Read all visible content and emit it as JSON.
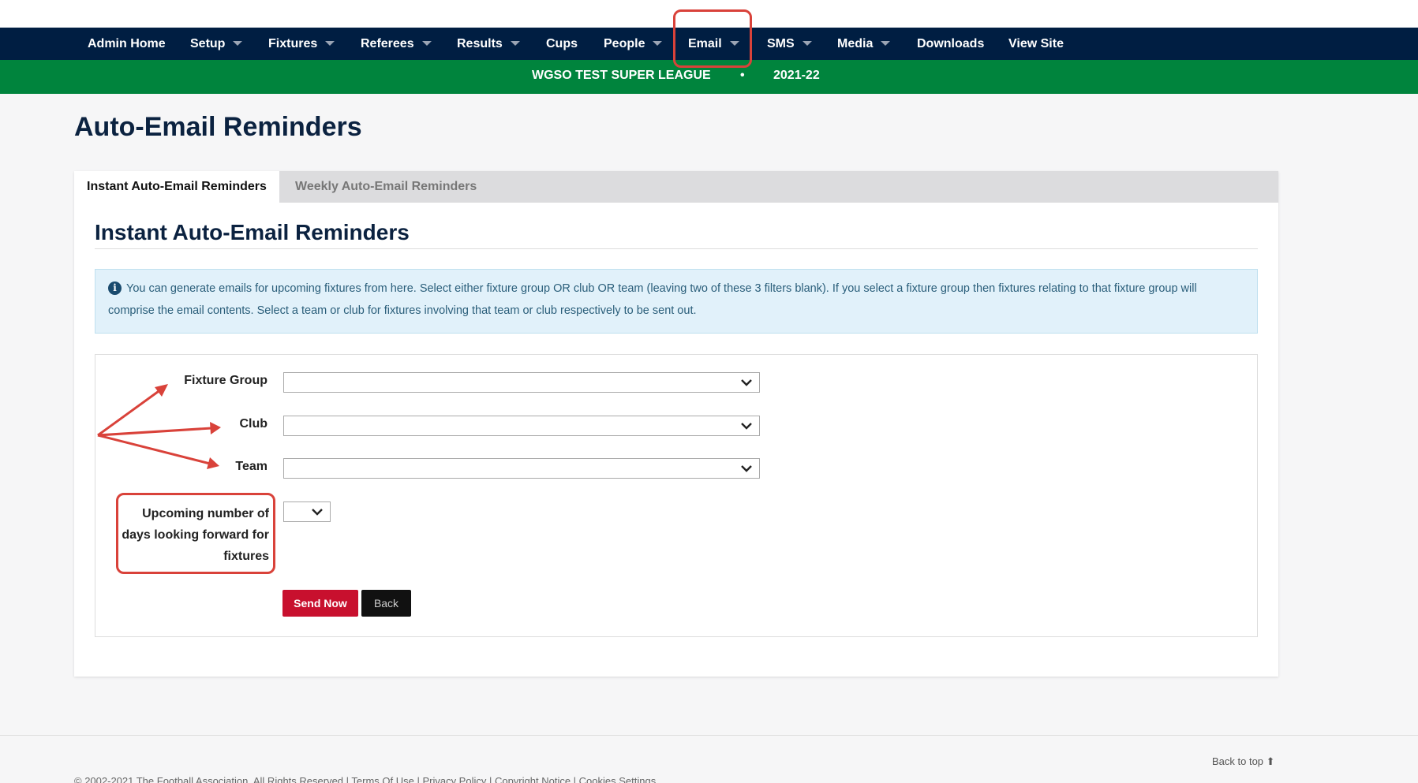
{
  "nav": {
    "items": [
      {
        "label": "Admin Home"
      },
      {
        "label": "Setup"
      },
      {
        "label": "Fixtures"
      },
      {
        "label": "Referees"
      },
      {
        "label": "Results"
      },
      {
        "label": "Cups"
      },
      {
        "label": "People"
      },
      {
        "label": "Email"
      },
      {
        "label": "SMS"
      },
      {
        "label": "Media"
      },
      {
        "label": "Downloads"
      },
      {
        "label": "View Site"
      }
    ]
  },
  "subbar": {
    "league": "WGSO TEST SUPER LEAGUE",
    "separator": "•",
    "season": "2021-22"
  },
  "page": {
    "title": "Auto-Email Reminders"
  },
  "tabs": {
    "instant": "Instant Auto-Email Reminders",
    "weekly": "Weekly Auto-Email Reminders"
  },
  "section": {
    "title": "Instant Auto-Email Reminders",
    "info_text": "You can generate emails for upcoming fixtures from here. Select either fixture group OR club OR team (leaving two of these 3 filters blank). If you select a fixture group then fixtures relating to that fixture group will comprise the email contents. Select a team or club for fixtures involving that team or club respectively to be sent out."
  },
  "form": {
    "fixture_group_label": "Fixture Group",
    "fixture_group_value": "",
    "club_label": "Club",
    "club_value": "",
    "team_label": "Team",
    "team_value": "",
    "days_label": "Upcoming number of days looking forward for fixtures",
    "days_value": "",
    "send_button": "Send Now",
    "back_button": "Back"
  },
  "footer": {
    "back_to_top": "Back to top ⬆",
    "copyright": "© 2002-2021 The Football Association. All Rights Reserved | Terms Of Use | Privacy Policy | Copyright Notice | Cookies Settings"
  },
  "colors": {
    "nav_bg": "#001e42",
    "subbar_bg": "#00843d",
    "send_button": "#c8102e",
    "annotation": "#d9423a"
  },
  "icons": {
    "info": "info-circle-icon",
    "dropdown": "chevron-down-icon",
    "nav_caret": "caret-down-icon"
  }
}
